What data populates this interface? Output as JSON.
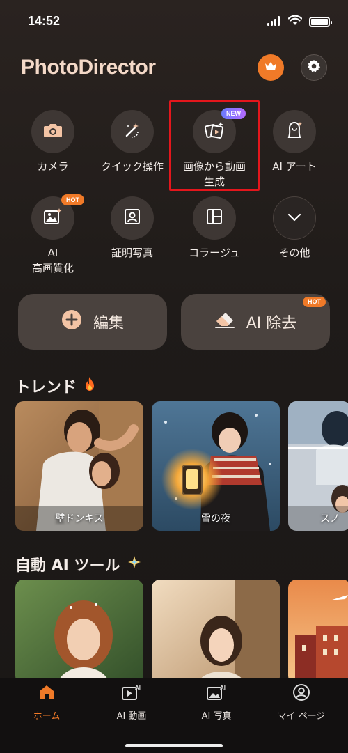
{
  "status": {
    "time": "14:52"
  },
  "header": {
    "title": "PhotoDirector"
  },
  "tools": [
    {
      "label": "カメラ",
      "icon": "camera-icon"
    },
    {
      "label": "クイック操作",
      "icon": "magic-wand-icon"
    },
    {
      "label": "画像から動画\n生成",
      "icon": "image-to-video-icon",
      "badge": "NEW"
    },
    {
      "label": "AI アート",
      "icon": "ai-art-icon"
    },
    {
      "label": "AI\n高画質化",
      "icon": "enhance-icon",
      "badge": "HOT"
    },
    {
      "label": "証明写真",
      "icon": "id-photo-icon"
    },
    {
      "label": "コラージュ",
      "icon": "collage-icon"
    },
    {
      "label": "その他",
      "icon": "chevron-down-icon"
    }
  ],
  "actions": {
    "edit": {
      "label": "編集"
    },
    "remove": {
      "label": "AI 除去",
      "badge": "HOT"
    }
  },
  "trend": {
    "title": "トレンド",
    "cards": [
      {
        "label": "壁ドンキス"
      },
      {
        "label": "雪の夜"
      },
      {
        "label": "スノ"
      }
    ]
  },
  "auto_tools": {
    "title": "自動 AI ツール"
  },
  "tabbar": {
    "items": [
      {
        "label": "ホーム",
        "active": true
      },
      {
        "label": "AI 動画"
      },
      {
        "label": "AI 写真"
      },
      {
        "label": "マイ ページ"
      }
    ]
  },
  "colors": {
    "accent": "#f07a28",
    "highlight": "#e4161c"
  }
}
